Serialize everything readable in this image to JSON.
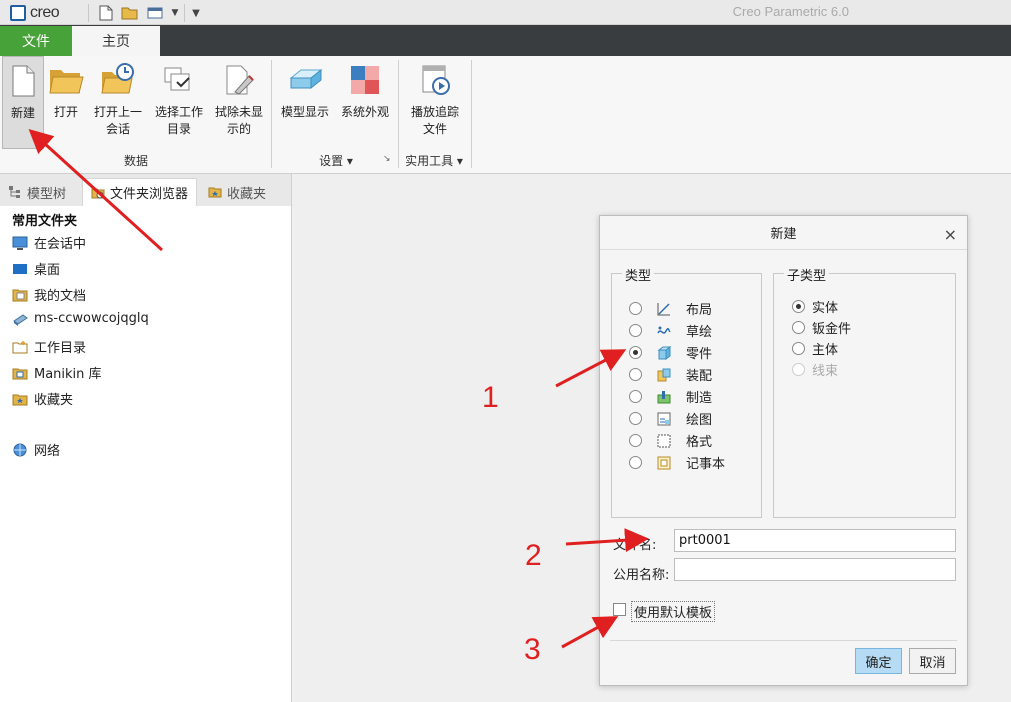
{
  "title_bar": {
    "logo_text": "creo",
    "app_title": "Creo Parametric 6.0"
  },
  "tabs": [
    {
      "label": "文件",
      "active": false
    },
    {
      "label": "主页",
      "active": true
    }
  ],
  "ribbon": {
    "buttons": [
      {
        "label_line1": "新建",
        "label_line2": "",
        "icon": "new-file-icon"
      },
      {
        "label_line1": "打开",
        "label_line2": "",
        "icon": "open-folder-icon"
      },
      {
        "label_line1": "打开上一",
        "label_line2": "会话",
        "icon": "open-last-session-icon"
      },
      {
        "label_line1": "选择工作",
        "label_line2": "目录",
        "icon": "select-working-dir-icon"
      },
      {
        "label_line1": "拭除未显",
        "label_line2": "示的",
        "icon": "erase-not-displayed-icon"
      },
      {
        "label_line1": "模型显示",
        "label_line2": "",
        "icon": "model-display-icon"
      },
      {
        "label_line1": "系统外观",
        "label_line2": "",
        "icon": "system-appearance-icon"
      },
      {
        "label_line1": "播放追踪",
        "label_line2": "文件",
        "icon": "play-trail-file-icon"
      }
    ],
    "groups": [
      {
        "label": "数据"
      },
      {
        "label": "设置 ▾"
      },
      {
        "label": "实用工具 ▾"
      }
    ]
  },
  "left_panel": {
    "tabs": [
      {
        "label": "模型树",
        "icon": "model-tree-icon"
      },
      {
        "label": "文件夹浏览器",
        "icon": "folder-browser-icon"
      },
      {
        "label": "收藏夹",
        "icon": "favorites-icon"
      }
    ],
    "section_title": "常用文件夹",
    "items": [
      {
        "label": "在会话中",
        "icon": "in-session-icon"
      },
      {
        "label": "桌面",
        "icon": "desktop-icon"
      },
      {
        "label": "我的文档",
        "icon": "my-documents-icon"
      },
      {
        "label": "ms-ccwowcojqglq",
        "icon": "computer-icon"
      },
      {
        "label": "工作目录",
        "icon": "working-directory-icon"
      },
      {
        "label": "Manikin 库",
        "icon": "manikin-library-icon"
      },
      {
        "label": "收藏夹",
        "icon": "favorites-icon"
      },
      {
        "label": "网络",
        "icon": "network-icon"
      }
    ]
  },
  "dialog": {
    "title": "新建",
    "type_legend": "类型",
    "types": [
      {
        "label": "布局",
        "selected": false,
        "icon": "layout-icon"
      },
      {
        "label": "草绘",
        "selected": false,
        "icon": "sketch-icon"
      },
      {
        "label": "零件",
        "selected": true,
        "icon": "part-icon"
      },
      {
        "label": "装配",
        "selected": false,
        "icon": "assembly-icon"
      },
      {
        "label": "制造",
        "selected": false,
        "icon": "manufacturing-icon"
      },
      {
        "label": "绘图",
        "selected": false,
        "icon": "drawing-icon"
      },
      {
        "label": "格式",
        "selected": false,
        "icon": "format-icon"
      },
      {
        "label": "记事本",
        "selected": false,
        "icon": "notebook-icon"
      }
    ],
    "subtype_legend": "子类型",
    "subtypes": [
      {
        "label": "实体",
        "selected": true,
        "disabled": false
      },
      {
        "label": "钣金件",
        "selected": false,
        "disabled": false
      },
      {
        "label": "主体",
        "selected": false,
        "disabled": false
      },
      {
        "label": "线束",
        "selected": false,
        "disabled": true
      }
    ],
    "filename_label": "文件名:",
    "filename_value": "prt0001",
    "common_name_label": "公用名称:",
    "common_name_value": "",
    "use_default_template_label": "使用默认模板",
    "use_default_template_checked": false,
    "ok_label": "确定",
    "cancel_label": "取消"
  },
  "annotations": {
    "step1": "1",
    "step2": "2",
    "step3": "3",
    "arrow_color": "#e02020"
  },
  "colors": {
    "file_tab": "#48a23a",
    "tab_bar": "#3a3d40",
    "primary_button": "#b6dcf5"
  }
}
